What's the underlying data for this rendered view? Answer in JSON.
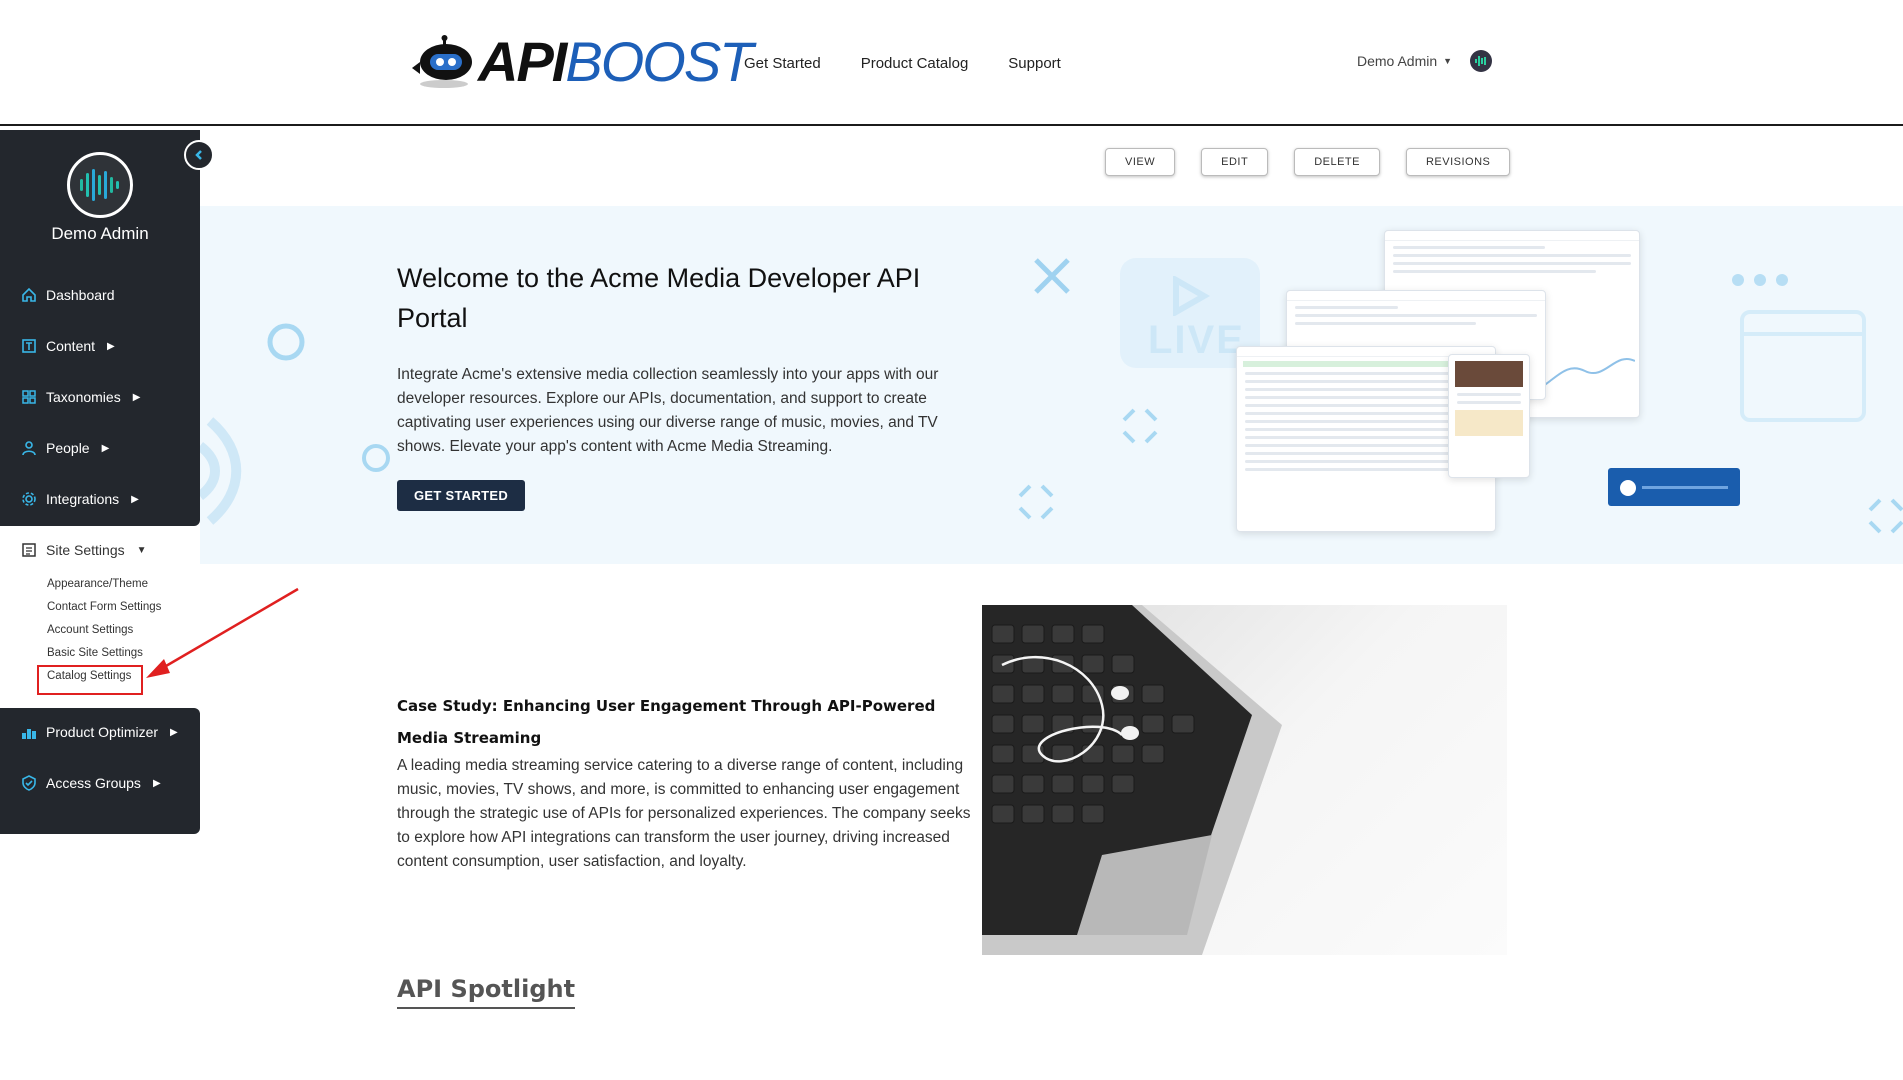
{
  "header": {
    "logo_api": "API",
    "logo_boost": "BOOST",
    "nav": [
      "Get Started",
      "Product Catalog",
      "Support"
    ],
    "user_label": "Demo Admin"
  },
  "sidebar": {
    "user_name": "Demo Admin",
    "items_top": [
      {
        "label": "Dashboard",
        "icon": "home-icon"
      },
      {
        "label": "Content",
        "icon": "content-icon"
      },
      {
        "label": "Taxonomies",
        "icon": "grid-icon"
      },
      {
        "label": "People",
        "icon": "person-icon"
      },
      {
        "label": "Integrations",
        "icon": "gear-icon"
      }
    ],
    "site_settings": {
      "label": "Site Settings",
      "sub_items": [
        "Appearance/Theme",
        "Contact Form Settings",
        "Account Settings",
        "Basic Site Settings",
        "Catalog Settings"
      ]
    },
    "items_bottom": [
      {
        "label": "Product Optimizer",
        "icon": "optimizer-icon"
      },
      {
        "label": "Access Groups",
        "icon": "shield-icon"
      }
    ]
  },
  "actions": [
    "VIEW",
    "EDIT",
    "DELETE",
    "REVISIONS"
  ],
  "hero": {
    "title": "Welcome to the Acme Media Developer API Portal",
    "description": "Integrate Acme's extensive media collection seamlessly into your apps with our developer resources. Explore our APIs, documentation, and support to create captivating user experiences using our diverse range of music, movies, and TV shows. Elevate your app's content with Acme Media Streaming.",
    "button": "GET STARTED",
    "live_badge": "LIVE"
  },
  "case_study": {
    "title": "Case Study: Enhancing User Engagement Through API-Powered Media Streaming",
    "description": "A leading media streaming service catering to a diverse range of content, including music, movies, TV shows, and more, is committed to enhancing user engagement through the strategic use of APIs for personalized experiences. The company seeks to explore how API integrations can transform the user journey, driving increased content consumption, user satisfaction, and loyalty."
  },
  "spotlight": {
    "title": "API Spotlight"
  },
  "colors": {
    "sidebar_bg": "#23272d",
    "accent_blue": "#1d5fb8",
    "hero_bg": "#f0f8fd",
    "highlight_red": "#e02020"
  }
}
